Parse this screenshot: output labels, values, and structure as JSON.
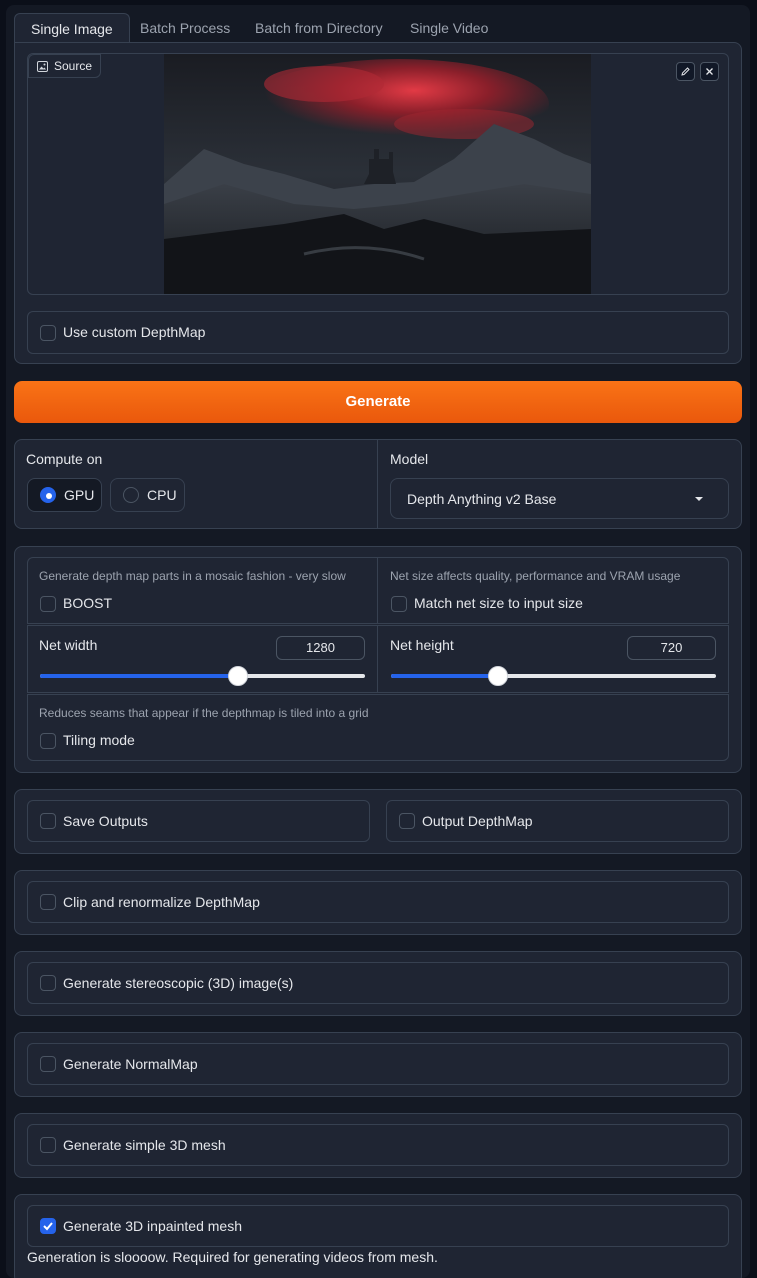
{
  "tabs": [
    {
      "label": "Single Image",
      "active": true
    },
    {
      "label": "Batch Process",
      "active": false
    },
    {
      "label": "Batch from Directory",
      "active": false
    },
    {
      "label": "Single Video",
      "active": false
    }
  ],
  "source": {
    "label": "Source"
  },
  "custom_depthmap": {
    "label": "Use custom DepthMap",
    "checked": false
  },
  "generate_button": {
    "label": "Generate",
    "color": "#f97316"
  },
  "compute": {
    "label": "Compute on",
    "options": [
      {
        "label": "GPU",
        "selected": true
      },
      {
        "label": "CPU",
        "selected": false
      }
    ]
  },
  "model": {
    "label": "Model",
    "value": "Depth Anything v2 Base"
  },
  "boost": {
    "info": "Generate depth map parts in a mosaic fashion - very slow",
    "label": "BOOST",
    "checked": false
  },
  "match_net": {
    "info": "Net size affects quality, performance and VRAM usage",
    "label": "Match net size to input size",
    "checked": false
  },
  "net_width": {
    "label": "Net width",
    "value": "1280",
    "fraction": 0.61
  },
  "net_height": {
    "label": "Net height",
    "value": "720",
    "fraction": 0.33
  },
  "tiling": {
    "info": "Reduces seams that appear if the depthmap is tiled into a grid",
    "label": "Tiling mode",
    "checked": false
  },
  "save_outputs": {
    "label": "Save Outputs",
    "checked": false
  },
  "output_depthmap": {
    "label": "Output DepthMap",
    "checked": false
  },
  "clip_renormalize": {
    "label": "Clip and renormalize DepthMap",
    "checked": false
  },
  "stereoscopic": {
    "label": "Generate stereoscopic (3D) image(s)",
    "checked": false
  },
  "normalmap": {
    "label": "Generate NormalMap",
    "checked": false
  },
  "simple_mesh": {
    "label": "Generate simple 3D mesh",
    "checked": false
  },
  "inpainted_mesh": {
    "label": "Generate 3D inpainted mesh",
    "checked": true,
    "note": "Generation is sloooow. Required for generating videos from mesh."
  },
  "colors": {
    "accent": "#2563eb",
    "background": "#0b0f19",
    "panel": "#1f2533"
  }
}
